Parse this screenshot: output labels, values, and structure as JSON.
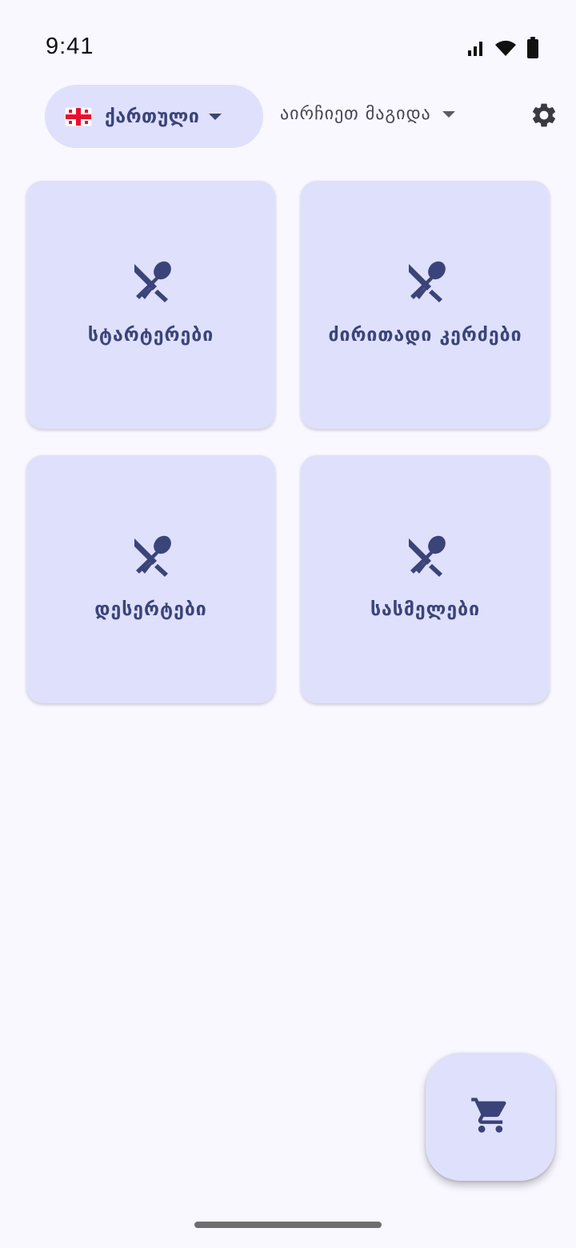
{
  "status_bar": {
    "time": "9:41",
    "icons": [
      "signal-icon",
      "wifi-icon",
      "battery-icon"
    ]
  },
  "header": {
    "language": {
      "flag": "georgia-flag-icon",
      "label": "ქართული"
    },
    "table_select": {
      "label": "აირჩიეთ მაგიდა"
    },
    "settings_icon": "gear-icon"
  },
  "categories": [
    {
      "label": "სტარტერები",
      "icon": "restaurant-icon"
    },
    {
      "label": "ძირითადი კერძები",
      "icon": "restaurant-icon"
    },
    {
      "label": "დესერტები",
      "icon": "restaurant-icon"
    },
    {
      "label": "სასმელები",
      "icon": "restaurant-icon"
    }
  ],
  "fab": {
    "icon": "cart-icon"
  },
  "colors": {
    "background": "#f9f7ff",
    "card": "#dfe0fb",
    "accent": "#3a4478"
  }
}
